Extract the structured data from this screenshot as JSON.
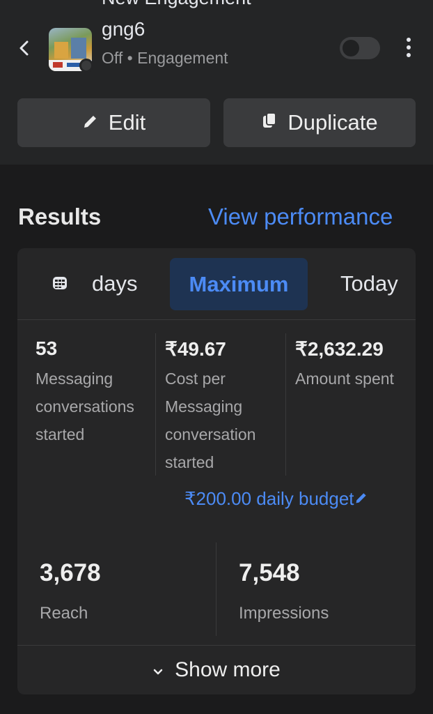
{
  "header": {
    "top_title": "New Engagement",
    "ad_name": "gng6",
    "status": "Off",
    "separator": "•",
    "objective": "Engagement",
    "toggle_on": false
  },
  "actions": {
    "edit_label": "Edit",
    "duplicate_label": "Duplicate"
  },
  "results": {
    "title": "Results",
    "view_performance": "View performance",
    "tabs": [
      {
        "label": "days",
        "selected": false
      },
      {
        "label": "Maximum",
        "selected": true
      },
      {
        "label": "Today",
        "selected": false
      }
    ],
    "metrics": [
      {
        "value": "53",
        "label": "Messaging conversations started"
      },
      {
        "value": "₹49.67",
        "label": "Cost per Messaging conversation started"
      },
      {
        "value": "₹2,632.29",
        "label": "Amount spent"
      }
    ],
    "daily_budget": "₹200.00 daily budget",
    "reach": {
      "value": "3,678",
      "label": "Reach"
    },
    "impressions": {
      "value": "7,548",
      "label": "Impressions"
    },
    "show_more": "Show more"
  },
  "colors": {
    "accent_blue": "#4c8bf5",
    "selected_tab_bg": "#1e3352",
    "background": "#1b1b1c"
  },
  "icons": [
    "back-chevron-icon",
    "more-vert-icon",
    "pencil-icon",
    "duplicate-icon",
    "calendar-icon",
    "chevron-down-icon"
  ]
}
